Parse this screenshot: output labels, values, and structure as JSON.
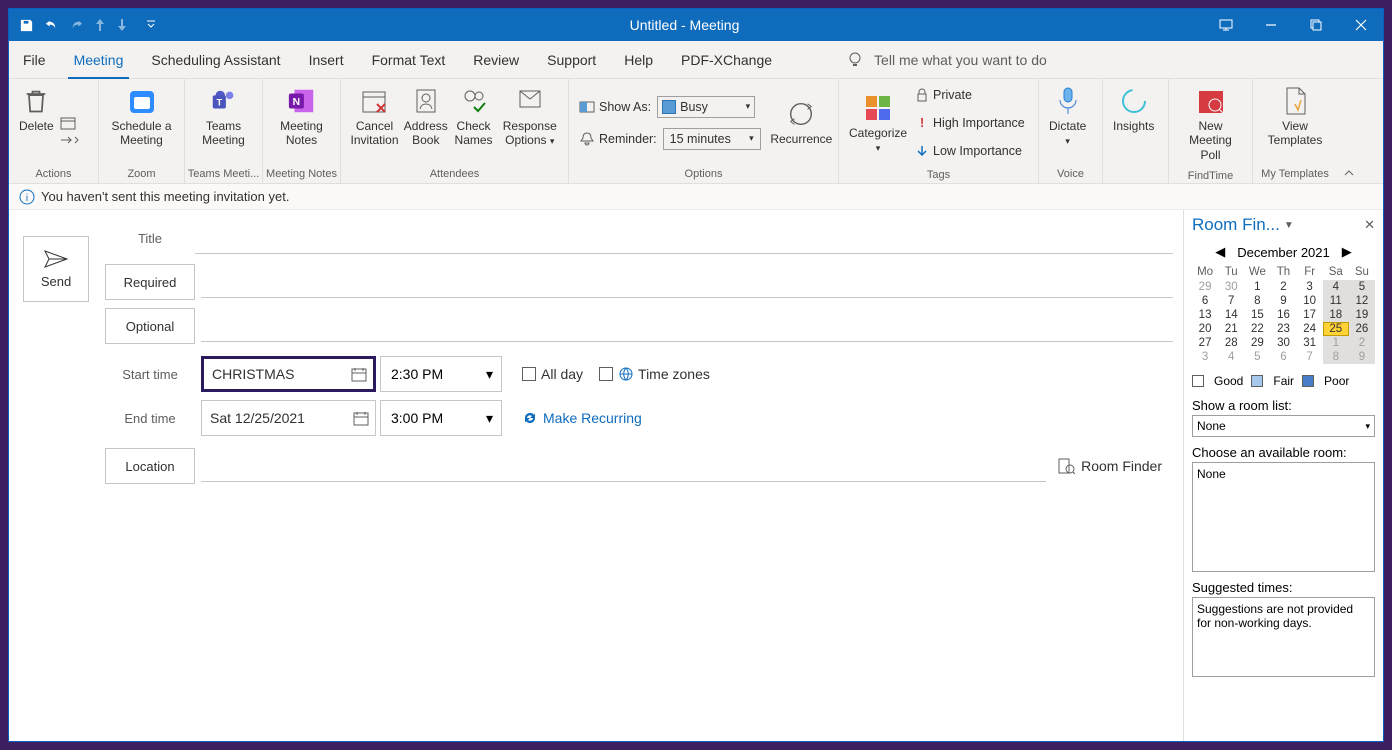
{
  "titlebar": {
    "title": "Untitled  -  Meeting"
  },
  "menu": {
    "tabs": [
      "File",
      "Meeting",
      "Scheduling Assistant",
      "Insert",
      "Format Text",
      "Review",
      "Support",
      "Help",
      "PDF-XChange"
    ],
    "activeIndex": 1,
    "tellme": "Tell me what you want to do"
  },
  "ribbon": {
    "actions": {
      "delete": "Delete",
      "group": "Actions"
    },
    "zoom": {
      "schedule": "Schedule a Meeting",
      "group": "Zoom"
    },
    "teams": {
      "btn": "Teams Meeting",
      "group": "Teams Meeti..."
    },
    "notes": {
      "btn": "Meeting Notes",
      "group": "Meeting Notes"
    },
    "attendees": {
      "cancel": "Cancel Invitation",
      "address": "Address Book",
      "check": "Check Names",
      "response": "Response Options",
      "group": "Attendees"
    },
    "options": {
      "showas_label": "Show As:",
      "showas_value": "Busy",
      "reminder_label": "Reminder:",
      "reminder_value": "15 minutes",
      "recurrence": "Recurrence",
      "group": "Options"
    },
    "tags": {
      "categorize": "Categorize",
      "private": "Private",
      "high": "High Importance",
      "low": "Low Importance",
      "group": "Tags"
    },
    "voice": {
      "dictate": "Dictate",
      "group": "Voice"
    },
    "insights": {
      "btn": "Insights"
    },
    "findtime": {
      "btn": "New Meeting Poll",
      "group": "FindTime"
    },
    "templates": {
      "btn": "View Templates",
      "group": "My Templates"
    }
  },
  "infobar": "You haven't sent this meeting invitation yet.",
  "form": {
    "send": "Send",
    "title_label": "Title",
    "required": "Required",
    "optional": "Optional",
    "start_label": "Start time",
    "end_label": "End time",
    "location_label": "Location",
    "start_date": "CHRISTMAS",
    "start_time": "2:30 PM",
    "end_date": "Sat 12/25/2021",
    "end_time": "3:00 PM",
    "allday": "All day",
    "timezones": "Time zones",
    "make_recurring": "Make Recurring",
    "room_finder": "Room Finder"
  },
  "panel": {
    "title": "Room Fin...",
    "month": "December 2021",
    "weekdays": [
      "Mo",
      "Tu",
      "We",
      "Th",
      "Fr",
      "Sa",
      "Su"
    ],
    "weeks": [
      [
        {
          "n": 29,
          "m": true
        },
        {
          "n": 30,
          "m": true
        },
        {
          "n": 1
        },
        {
          "n": 2
        },
        {
          "n": 3
        },
        {
          "n": 4,
          "hl": true
        },
        {
          "n": 5,
          "hl": true
        }
      ],
      [
        {
          "n": 6
        },
        {
          "n": 7
        },
        {
          "n": 8
        },
        {
          "n": 9
        },
        {
          "n": 10
        },
        {
          "n": 11,
          "hl": true
        },
        {
          "n": 12,
          "hl": true
        }
      ],
      [
        {
          "n": 13
        },
        {
          "n": 14
        },
        {
          "n": 15
        },
        {
          "n": 16
        },
        {
          "n": 17
        },
        {
          "n": 18,
          "hl": true
        },
        {
          "n": 19,
          "hl": true
        }
      ],
      [
        {
          "n": 20
        },
        {
          "n": 21
        },
        {
          "n": 22
        },
        {
          "n": 23
        },
        {
          "n": 24
        },
        {
          "n": 25,
          "sel": true
        },
        {
          "n": 26,
          "hl": true
        }
      ],
      [
        {
          "n": 27
        },
        {
          "n": 28
        },
        {
          "n": 29
        },
        {
          "n": 30
        },
        {
          "n": 31
        },
        {
          "n": 1,
          "m": true,
          "hl": true
        },
        {
          "n": 2,
          "m": true,
          "hl": true
        }
      ],
      [
        {
          "n": 3,
          "m": true
        },
        {
          "n": 4,
          "m": true
        },
        {
          "n": 5,
          "m": true
        },
        {
          "n": 6,
          "m": true
        },
        {
          "n": 7,
          "m": true
        },
        {
          "n": 8,
          "m": true,
          "hl": true
        },
        {
          "n": 9,
          "m": true,
          "hl": true
        }
      ]
    ],
    "legend": {
      "good": "Good",
      "fair": "Fair",
      "poor": "Poor"
    },
    "roomlist_label": "Show a room list:",
    "roomlist_value": "None",
    "choose_label": "Choose an available room:",
    "choose_value": "None",
    "suggested_label": "Suggested times:",
    "suggested_value": "Suggestions are not provided for non-working days."
  }
}
